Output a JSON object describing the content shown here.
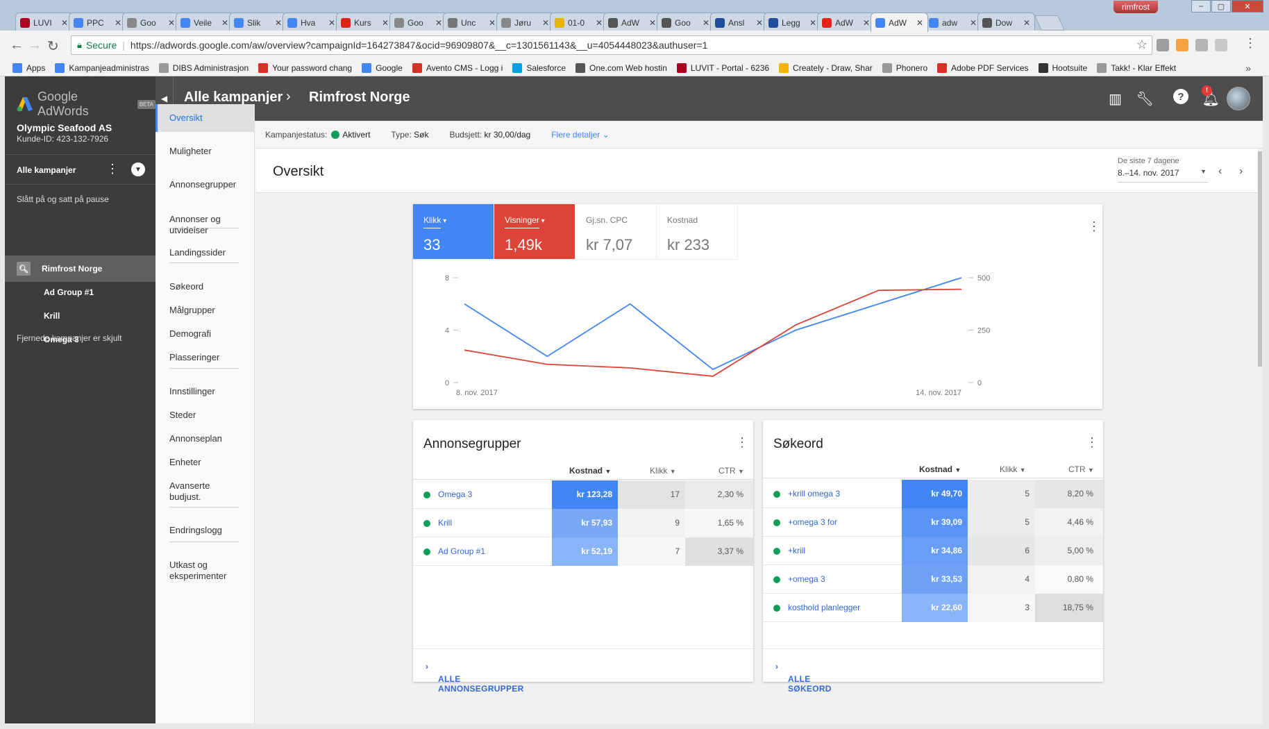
{
  "browser": {
    "profile_name": "rimfrost",
    "tabs": [
      {
        "label": "LUVI",
        "color": "#b00020"
      },
      {
        "label": "PPC",
        "color": "#4285f4"
      },
      {
        "label": "Goo",
        "color": "#888888"
      },
      {
        "label": "Veile",
        "color": "#4285f4"
      },
      {
        "label": "Slik",
        "color": "#4285f4"
      },
      {
        "label": "Hva",
        "color": "#4285f4"
      },
      {
        "label": "Kurs",
        "color": "#e62117"
      },
      {
        "label": "Goo",
        "color": "#888888"
      },
      {
        "label": "Unc",
        "color": "#777777"
      },
      {
        "label": "Jøru",
        "color": "#888888"
      },
      {
        "label": "01-0",
        "color": "#e8b400"
      },
      {
        "label": "AdW",
        "color": "#555555"
      },
      {
        "label": "Goo",
        "color": "#555555"
      },
      {
        "label": "Ansl",
        "color": "#1f4e9c"
      },
      {
        "label": "Legg",
        "color": "#1f4e9c"
      },
      {
        "label": "AdW",
        "color": "#e62117"
      },
      {
        "label": "AdW",
        "color": "#4285f4"
      },
      {
        "label": "adw",
        "color": "#4285f4"
      },
      {
        "label": "Dow",
        "color": "#555555"
      }
    ],
    "active_tab_index": 16,
    "secure_label": "Secure",
    "url": "https://adwords.google.com/aw/overview?campaignId=164273847&ocid=96909807&__c=1301561143&__u=4054448023&authuser=1",
    "bookmarks": [
      {
        "label": "Apps",
        "color": "#4285f4"
      },
      {
        "label": "Kampanjeadministras",
        "color": "#4285f4"
      },
      {
        "label": "DIBS Administrasjon",
        "color": "#999999"
      },
      {
        "label": "Your password chang",
        "color": "#d93025"
      },
      {
        "label": "Google",
        "color": "#4285f4"
      },
      {
        "label": "Avento CMS - Logg i",
        "color": "#d93025"
      },
      {
        "label": "Salesforce",
        "color": "#00a1e0"
      },
      {
        "label": "One.com Web hostin",
        "color": "#555555"
      },
      {
        "label": "LUVIT - Portal - 6236",
        "color": "#b00020"
      },
      {
        "label": "Creately - Draw, Shar",
        "color": "#f4b400"
      },
      {
        "label": "Phonero",
        "color": "#999999"
      },
      {
        "label": "Adobe PDF Services",
        "color": "#d93025"
      },
      {
        "label": "Hootsuite",
        "color": "#333333"
      },
      {
        "label": "Takk! - Klar Effekt",
        "color": "#999999"
      }
    ],
    "bookmarks_more": "»"
  },
  "app": {
    "logo_text": "Google AdWords",
    "beta": "BETA",
    "account_name": "Olympic Seafood AS",
    "account_id": "Kunde-ID: 423-132-7926",
    "all_campaigns": "Alle kampanjer",
    "paused_header": "Slått på og satt på pause",
    "campaigns": [
      {
        "label": "Rimfrost Norge",
        "selected": true
      },
      {
        "label": "Ad Group #1",
        "selected": false
      },
      {
        "label": "Krill",
        "selected": false
      },
      {
        "label": "Omega 3",
        "selected": false
      }
    ],
    "removed_hidden": "Fjernede kampanjer er skjult",
    "breadcrumb_root": "Alle kampanjer",
    "breadcrumb_current": "Rimfrost Norge",
    "notification_count": "!"
  },
  "subnav": [
    "Oversikt",
    "Muligheter",
    "Annonsegrupper",
    "Annonser og utvidelser",
    "Landingssider",
    "Søkeord",
    "Målgrupper",
    "Demografi",
    "Plasseringer",
    "Innstillinger",
    "Steder",
    "Annonseplan",
    "Enheter",
    "Avanserte budjust.",
    "Endringslogg",
    "Utkast og eksperimenter"
  ],
  "status": {
    "status_label": "Kampanjestatus:",
    "status_value": "Aktivert",
    "type_label": "Type:",
    "type_value": "Søk",
    "budget_label": "Budsjett:",
    "budget_value": "kr 30,00/dag",
    "more_details": "Flere detaljer"
  },
  "overview": {
    "title": "Oversikt",
    "date_range_label": "De siste 7 dagene",
    "date_range_value": "8.–14. nov. 2017"
  },
  "metrics": [
    {
      "label": "Klikk",
      "value": "33",
      "color": "#4285f4"
    },
    {
      "label": "Visninger",
      "value": "1,49k",
      "color": "#db4437"
    },
    {
      "label": "Gj.sn. CPC",
      "value": "kr 7,07",
      "color": null
    },
    {
      "label": "Kostnad",
      "value": "kr 233",
      "color": null
    }
  ],
  "chart_data": {
    "type": "line",
    "x": [
      "2017-11-08",
      "2017-11-09",
      "2017-11-10",
      "2017-11-11",
      "2017-11-12",
      "2017-11-13",
      "2017-11-14"
    ],
    "x_tick_labels": [
      "8. nov. 2017",
      "14. nov. 2017"
    ],
    "series": [
      {
        "name": "Klikk",
        "axis": "left",
        "color": "#4285f4",
        "values": [
          6,
          2,
          6,
          1,
          4,
          6,
          8
        ]
      },
      {
        "name": "Visninger",
        "axis": "right",
        "color": "#db4437",
        "values": [
          155,
          87,
          70,
          30,
          275,
          440,
          445
        ]
      }
    ],
    "y_left": {
      "ticks": [
        0,
        4,
        8
      ],
      "ylim": [
        0,
        8
      ]
    },
    "y_right": {
      "ticks": [
        0,
        250,
        500
      ],
      "ylim": [
        0,
        500
      ]
    },
    "grid": false,
    "title": "",
    "xlabel": "",
    "ylabel": ""
  },
  "adgroups": {
    "title": "Annonsegrupper",
    "columns": [
      "Kostnad",
      "Klikk",
      "CTR"
    ],
    "rows": [
      {
        "name": "Omega 3",
        "cost": "kr 123,28",
        "clicks": "17",
        "ctr": "2,30 %",
        "cost_color": "#4285f4",
        "ctr_bg": "#ebebeb"
      },
      {
        "name": "Krill",
        "cost": "kr 57,93",
        "clicks": "9",
        "ctr": "1,65 %",
        "cost_color": "#7aa8f7",
        "ctr_bg": "#f7f7f7"
      },
      {
        "name": "Ad Group #1",
        "cost": "kr 52,19",
        "clicks": "7",
        "ctr": "3,37 %",
        "cost_color": "#8ab4f8",
        "ctr_bg": "#e0e0e0"
      }
    ],
    "clicks_bg": [
      "#e3e3e3",
      "#f2f2f2",
      "#f7f7f7"
    ],
    "footer": "ALLE ANNONSEGRUPPER"
  },
  "keywords": {
    "title": "Søkeord",
    "columns": [
      "Kostnad",
      "Klikk",
      "CTR"
    ],
    "rows": [
      {
        "name": "+krill omega 3",
        "cost": "kr 49,70",
        "clicks": "5",
        "ctr": "8,20 %",
        "cost_color": "#4285f4",
        "ctr_bg": "#e6e6e6"
      },
      {
        "name": "+omega 3 for",
        "cost": "kr 39,09",
        "clicks": "5",
        "ctr": "4,46 %",
        "cost_color": "#5a95f5",
        "ctr_bg": "#f2f2f2"
      },
      {
        "name": "+krill",
        "cost": "kr 34,86",
        "clicks": "6",
        "ctr": "5,00 %",
        "cost_color": "#6a9ef6",
        "ctr_bg": "#eeeeee"
      },
      {
        "name": "+omega 3",
        "cost": "kr 33,53",
        "clicks": "4",
        "ctr": "0,80 %",
        "cost_color": "#6fa2f6",
        "ctr_bg": "#fafafa"
      },
      {
        "name": "kosthold planlegger",
        "cost": "kr 22,60",
        "clicks": "3",
        "ctr": "18,75 %",
        "cost_color": "#8ab4f8",
        "ctr_bg": "#dedede"
      }
    ],
    "clicks_bg": [
      "#ececec",
      "#ececec",
      "#e6e6e6",
      "#f2f2f2",
      "#f7f7f7"
    ],
    "footer": "ALLE SØKEORD"
  }
}
